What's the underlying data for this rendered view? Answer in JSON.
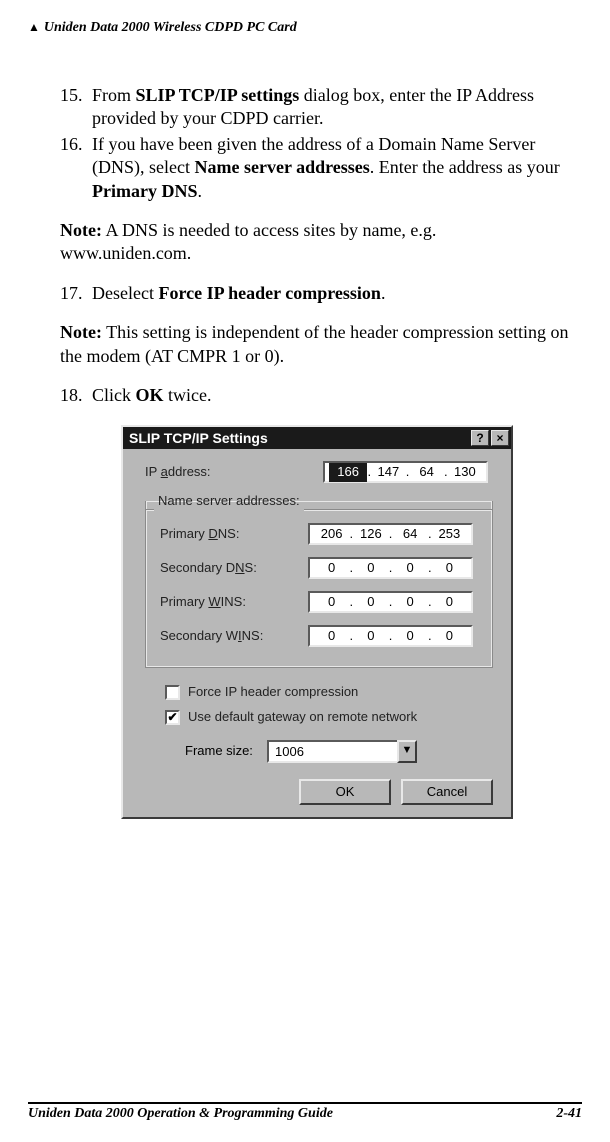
{
  "header": {
    "triangle": "▲",
    "title": "Uniden Data 2000 Wireless CDPD PC Card"
  },
  "steps": {
    "s15_num": "15.",
    "s15_a": "From ",
    "s15_b": "SLIP TCP/IP settings",
    "s15_c": " dialog box, enter the IP Address provided by your CDPD carrier.",
    "s16_num": "16.",
    "s16_a": "If you have been given the address of a Domain Name Server (DNS),  select ",
    "s16_b": "Name server addresses",
    "s16_c": ".  Enter the address as your ",
    "s16_d": "Primary DNS",
    "s16_e": ".",
    "s17_num": "17.",
    "s17_a": "Deselect ",
    "s17_b": "Force IP header compression",
    "s17_c": ".",
    "s18_num": "18.",
    "s18_a": "Click ",
    "s18_b": "OK",
    "s18_c": " twice."
  },
  "notes": {
    "n1_label": "Note:",
    "n1_text": "  A DNS is needed to access sites by name, e.g. ",
    "n1_text2": "www.uniden.com.",
    "n2_label": "Note:",
    "n2_text": "  This setting is independent of the header compression setting on the modem (AT CMPR 1 or 0)."
  },
  "dialog": {
    "title": "SLIP TCP/IP Settings",
    "help_btn": "?",
    "close_btn": "×",
    "ip_label_pre": "IP ",
    "ip_label_u": "a",
    "ip_label_post": "ddress:",
    "ip": [
      "166",
      "147",
      "64",
      "130"
    ],
    "legend": "Name server addresses:",
    "pdns_pre": "Primary ",
    "pdns_u": "D",
    "pdns_post": "NS:",
    "pdns": [
      "206",
      "126",
      "64",
      "253"
    ],
    "sdns_pre": "Secondary D",
    "sdns_u": "N",
    "sdns_post": "S:",
    "sdns": [
      "0",
      "0",
      "0",
      "0"
    ],
    "pwins_pre": "Primary ",
    "pwins_u": "W",
    "pwins_post": "INS:",
    "pwins": [
      "0",
      "0",
      "0",
      "0"
    ],
    "swins_pre": "Secondary W",
    "swins_u": "I",
    "swins_post": "NS:",
    "swins": [
      "0",
      "0",
      "0",
      "0"
    ],
    "chk1_pre": "Force IP header ",
    "chk1_u": "c",
    "chk1_post": "ompression",
    "chk2_u": "U",
    "chk2_post": "se default gateway on remote network",
    "chk2_mark": "✔",
    "frame_u": "F",
    "frame_post": "rame size:",
    "frame_val": "1006",
    "combo_arrow": "▼",
    "ok": "OK",
    "cancel": "Cancel"
  },
  "footer": {
    "title": "Uniden Data 2000 Operation & Programming Guide",
    "page": "2-41"
  }
}
